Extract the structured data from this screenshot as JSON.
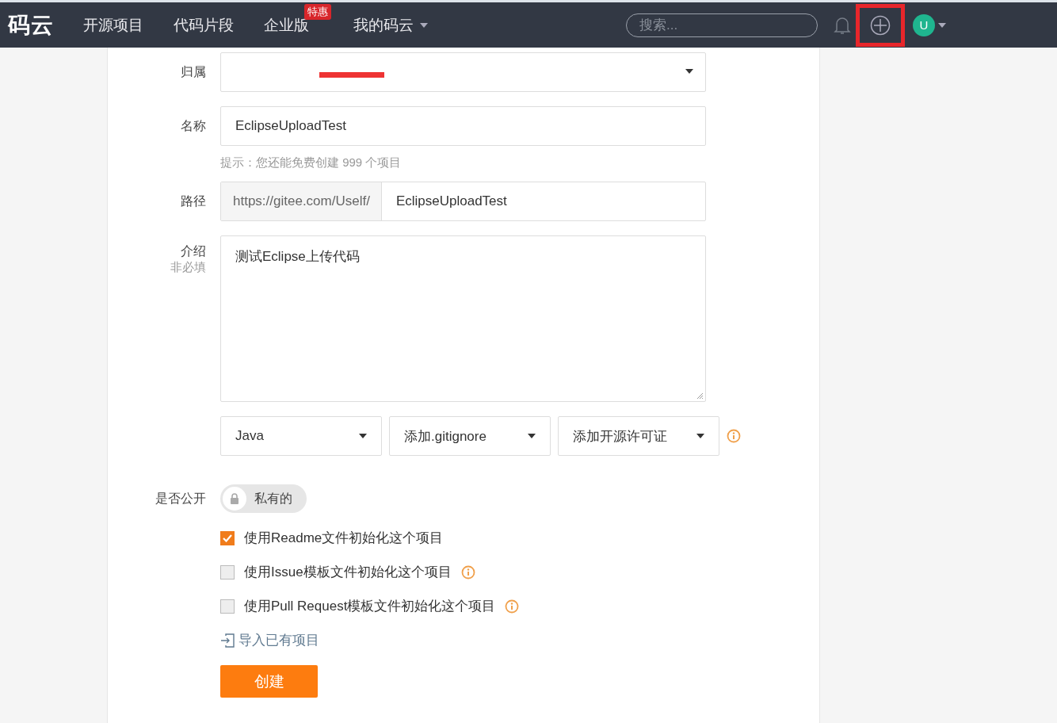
{
  "navbar": {
    "logo": "码云",
    "links": [
      {
        "label": "开源项目",
        "dropdown": false
      },
      {
        "label": "代码片段",
        "dropdown": false
      },
      {
        "label": "企业版",
        "badge": "特惠",
        "dropdown": false
      },
      {
        "label": "我的码云",
        "dropdown": true
      }
    ],
    "search": {
      "placeholder": "搜索..."
    },
    "avatar": "U"
  },
  "form": {
    "owner": {
      "label": "归属",
      "redacted": true
    },
    "name": {
      "label": "名称",
      "value": "EclipseUploadTest",
      "hint": "提示：您还能免费创建 999 个项目"
    },
    "path": {
      "label": "路径",
      "prefix": "https://gitee.com/Uself/",
      "value": "EclipseUploadTest"
    },
    "intro": {
      "label": "介绍",
      "sublabel": "非必填",
      "value": "测试Eclipse上传代码"
    },
    "selects": [
      {
        "value": "Java"
      },
      {
        "value": "添加.gitignore"
      },
      {
        "value": "添加开源许可证"
      }
    ],
    "visibility": {
      "label": "是否公开",
      "toggle_label": "私有的",
      "on": false
    },
    "checkboxes": [
      {
        "label": "使用Readme文件初始化这个项目",
        "checked": true,
        "info": false
      },
      {
        "label": "使用Issue模板文件初始化这个项目",
        "checked": false,
        "info": true
      },
      {
        "label": "使用Pull Request模板文件初始化这个项目",
        "checked": false,
        "info": true
      }
    ],
    "import_link": "导入已有项目",
    "submit": "创建"
  }
}
